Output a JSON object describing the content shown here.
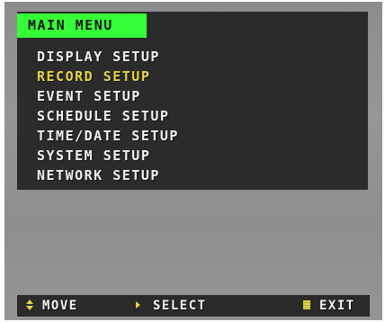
{
  "menu": {
    "title": "MAIN MENU",
    "items": [
      {
        "label": "DISPLAY SETUP",
        "selected": false
      },
      {
        "label": "RECORD SETUP",
        "selected": true
      },
      {
        "label": "EVENT SETUP",
        "selected": false
      },
      {
        "label": "SCHEDULE SETUP",
        "selected": false
      },
      {
        "label": "TIME/DATE SETUP",
        "selected": false
      },
      {
        "label": "SYSTEM SETUP",
        "selected": false
      },
      {
        "label": "NETWORK SETUP",
        "selected": false
      }
    ]
  },
  "footer": {
    "move_label": "MOVE",
    "select_label": "SELECT",
    "exit_label": "EXIT",
    "move_icon": "up-down-arrows-icon",
    "select_icon": "right-arrow-icon",
    "exit_icon": "menu-button-icon"
  },
  "colors": {
    "title_bg": "#35ff35",
    "highlight": "#e6d53f",
    "panel_bg": "#2b2b2b",
    "text": "#f2f2f2"
  }
}
